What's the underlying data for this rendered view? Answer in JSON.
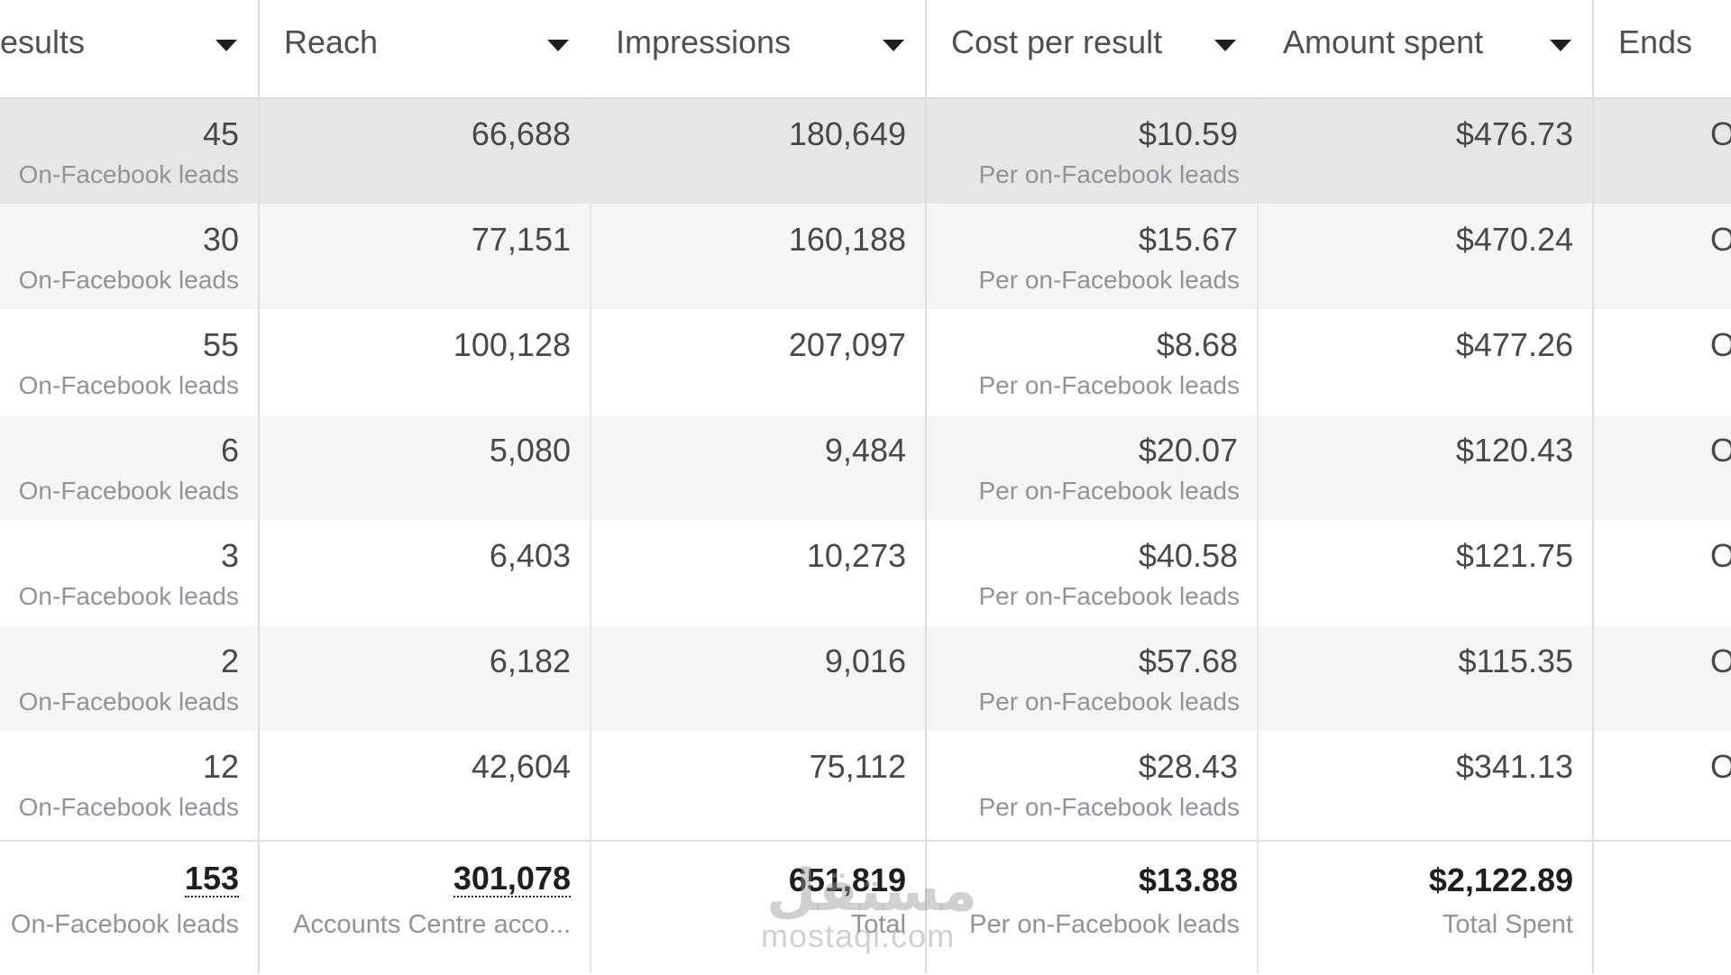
{
  "columns": [
    {
      "label": "esults"
    },
    {
      "label": "Reach"
    },
    {
      "label": "Impressions"
    },
    {
      "label": "Cost per result"
    },
    {
      "label": "Amount spent"
    },
    {
      "label": "Ends"
    }
  ],
  "rows": [
    {
      "results": "45",
      "results_sub": "On-Facebook leads",
      "reach": "66,688",
      "impressions": "180,649",
      "cost": "$10.59",
      "cost_sub": "Per on-Facebook leads",
      "amount": "$476.73",
      "ends": "O"
    },
    {
      "results": "30",
      "results_sub": "On-Facebook leads",
      "reach": "77,151",
      "impressions": "160,188",
      "cost": "$15.67",
      "cost_sub": "Per on-Facebook leads",
      "amount": "$470.24",
      "ends": "O"
    },
    {
      "results": "55",
      "results_sub": "On-Facebook leads",
      "reach": "100,128",
      "impressions": "207,097",
      "cost": "$8.68",
      "cost_sub": "Per on-Facebook leads",
      "amount": "$477.26",
      "ends": "O"
    },
    {
      "results": "6",
      "results_sub": "On-Facebook leads",
      "reach": "5,080",
      "impressions": "9,484",
      "cost": "$20.07",
      "cost_sub": "Per on-Facebook leads",
      "amount": "$120.43",
      "ends": "O"
    },
    {
      "results": "3",
      "results_sub": "On-Facebook leads",
      "reach": "6,403",
      "impressions": "10,273",
      "cost": "$40.58",
      "cost_sub": "Per on-Facebook leads",
      "amount": "$121.75",
      "ends": "O"
    },
    {
      "results": "2",
      "results_sub": "On-Facebook leads",
      "reach": "6,182",
      "impressions": "9,016",
      "cost": "$57.68",
      "cost_sub": "Per on-Facebook leads",
      "amount": "$115.35",
      "ends": "O"
    },
    {
      "results": "12",
      "results_sub": "On-Facebook leads",
      "reach": "42,604",
      "impressions": "75,112",
      "cost": "$28.43",
      "cost_sub": "Per on-Facebook leads",
      "amount": "$341.13",
      "ends": "O"
    }
  ],
  "totals": {
    "results": "153",
    "results_sub": "On-Facebook leads",
    "reach": "301,078",
    "reach_sub": "Accounts Centre acco...",
    "impressions": "651,819",
    "impressions_sub": "Total",
    "cost": "$13.88",
    "cost_sub": "Per on-Facebook leads",
    "amount": "$2,122.89",
    "amount_sub": "Total Spent"
  },
  "watermark": {
    "arabic": "مستقل",
    "latin": "mostaqi.com"
  },
  "colors": {
    "highlight_row": "#e6e6e6",
    "alt_row": "#f4f5f7",
    "border": "#dadde1"
  }
}
